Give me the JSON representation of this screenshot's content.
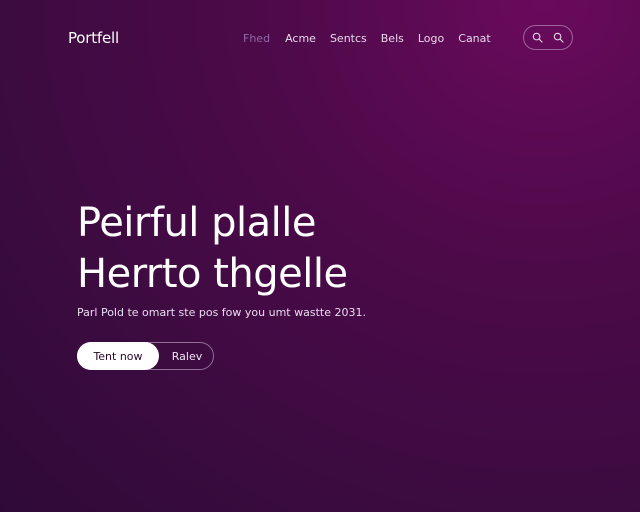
{
  "header": {
    "brand": "Portfell",
    "nav": [
      {
        "label": "Fhed",
        "active": true
      },
      {
        "label": "Acme",
        "active": false
      },
      {
        "label": "Sentcs",
        "active": false
      },
      {
        "label": "Bels",
        "active": false
      },
      {
        "label": "Logo",
        "active": false
      },
      {
        "label": "Canat",
        "active": false
      }
    ],
    "search_icons": [
      "search-icon",
      "search-icon"
    ]
  },
  "hero": {
    "title_line1": "Peirful plalle",
    "title_line2": "Herrto thgelle",
    "subtitle": "Parl Pold te omart ste pos fow you umt wastte 2031.",
    "primary_button": "Tent now",
    "secondary_button": "Ralev"
  },
  "colors": {
    "background": "#3f0b42",
    "accent_nav_active": "#8f6aa6",
    "button_primary_bg": "#ffffff",
    "button_primary_text": "#2a0a2c"
  }
}
